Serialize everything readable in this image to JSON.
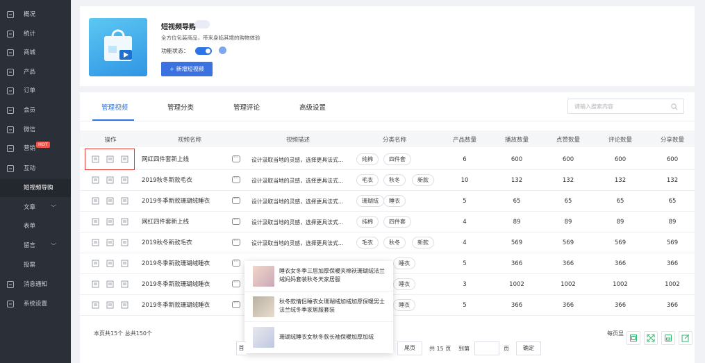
{
  "sidebar": {
    "items": [
      {
        "label": "概况",
        "icon": "monitor-icon"
      },
      {
        "label": "统计",
        "icon": "chart-icon"
      },
      {
        "label": "商城",
        "icon": "store-icon"
      },
      {
        "label": "产品",
        "icon": "grid-icon"
      },
      {
        "label": "订单",
        "icon": "clipboard-icon"
      },
      {
        "label": "会员",
        "icon": "members-icon"
      },
      {
        "label": "微信",
        "icon": "wechat-icon"
      },
      {
        "label": "营销",
        "icon": "marketing-icon",
        "badge": "HOT"
      },
      {
        "label": "互动",
        "icon": "interaction-icon"
      },
      {
        "label": "短视频导购",
        "sub": true,
        "selected": true
      },
      {
        "label": "文章",
        "sub": true,
        "arrow": "﹀"
      },
      {
        "label": "表单",
        "sub": true
      },
      {
        "label": "留言",
        "sub": true,
        "arrow": "﹀"
      },
      {
        "label": "投票",
        "sub": true
      },
      {
        "label": "消息通知",
        "icon": "bell-icon"
      },
      {
        "label": "系统设置",
        "icon": "settings-icon"
      }
    ]
  },
  "header": {
    "title": "短视频导购",
    "desc": "全方位包装商品，带来身临其境的购物体验",
    "status_label": "功能状态：",
    "add_button": "+ 新增短视频"
  },
  "tabs": [
    {
      "label": "管理视频",
      "active": true
    },
    {
      "label": "管理分类"
    },
    {
      "label": "管理评论"
    },
    {
      "label": "高级设置"
    }
  ],
  "search": {
    "placeholder": "请输入搜索内容"
  },
  "columns": [
    "操作",
    "视频名称",
    "视频描述",
    "分类名称",
    "产品数量",
    "播放数量",
    "点赞数量",
    "评论数量",
    "分享数量"
  ],
  "rows": [
    {
      "name": "网红四件套新上线",
      "desc": "设计汲取当地的灵感，选择更具法式...",
      "tags": [
        "纯棉",
        "四件套"
      ],
      "products": "6",
      "plays": "600",
      "likes": "600",
      "comments": "600",
      "shares": "600"
    },
    {
      "name": "2019秋冬新款毛衣",
      "desc": "设计汲取当地的灵感，选择更具法式...",
      "tags": [
        "毛衣",
        "秋冬",
        "新款"
      ],
      "products": "10",
      "plays": "132",
      "likes": "132",
      "comments": "132",
      "shares": "132"
    },
    {
      "name": "2019冬季新款珊瑚绒睡衣",
      "desc": "设计汲取当地的灵感，选择更具法式...",
      "tags": [
        "珊瑚绒",
        "睡衣"
      ],
      "products": "5",
      "plays": "65",
      "likes": "65",
      "comments": "65",
      "shares": "65"
    },
    {
      "name": "网红四件套新上线",
      "desc": "设计汲取当地的灵感，选择更具法式...",
      "tags": [
        "纯棉",
        "四件套"
      ],
      "products": "4",
      "plays": "89",
      "likes": "89",
      "comments": "89",
      "shares": "89"
    },
    {
      "name": "2019秋冬新款毛衣",
      "desc": "设计汲取当地的灵感，选择更具法式...",
      "tags": [
        "毛衣",
        "秋冬",
        "新款"
      ],
      "products": "4",
      "plays": "569",
      "likes": "569",
      "comments": "569",
      "shares": "569"
    },
    {
      "name": "2019冬季新款珊瑚绒睡衣",
      "desc": "",
      "tags": [
        "睡衣"
      ],
      "products": "5",
      "plays": "366",
      "likes": "366",
      "comments": "366",
      "shares": "366"
    },
    {
      "name": "2019冬季新款珊瑚绒睡衣",
      "desc": "",
      "tags": [
        "睡衣"
      ],
      "products": "3",
      "plays": "1002",
      "likes": "1002",
      "comments": "1002",
      "shares": "1002"
    },
    {
      "name": "2019冬季新款珊瑚绒睡衣",
      "desc": "",
      "tags": [
        "睡衣"
      ],
      "products": "5",
      "plays": "366",
      "likes": "366",
      "comments": "366",
      "shares": "366"
    }
  ],
  "popup": {
    "items": [
      {
        "text": "睡衣女冬季三层加厚保暖夹棉袄珊瑚绒法兰绒妈妈套装秋冬天家居服"
      },
      {
        "text": "秋冬款情侣睡衣女珊瑚绒加绒加厚保暖男士法兰绒冬季家居服套装"
      },
      {
        "text": "珊瑚绒睡衣女秋冬款长袖保暖加厚加绒"
      }
    ]
  },
  "footer": {
    "summary": "本页共15个 总共150个",
    "page_prefix": "首",
    "last": "尾页",
    "total_pages": "共 15 页",
    "goto": "到第",
    "page_unit": "页",
    "confirm": "确定",
    "per_page": "每页显"
  },
  "colors": {
    "accent": "#2d74e6",
    "sidebar": "#2b3038",
    "highlight": "#e53935"
  }
}
